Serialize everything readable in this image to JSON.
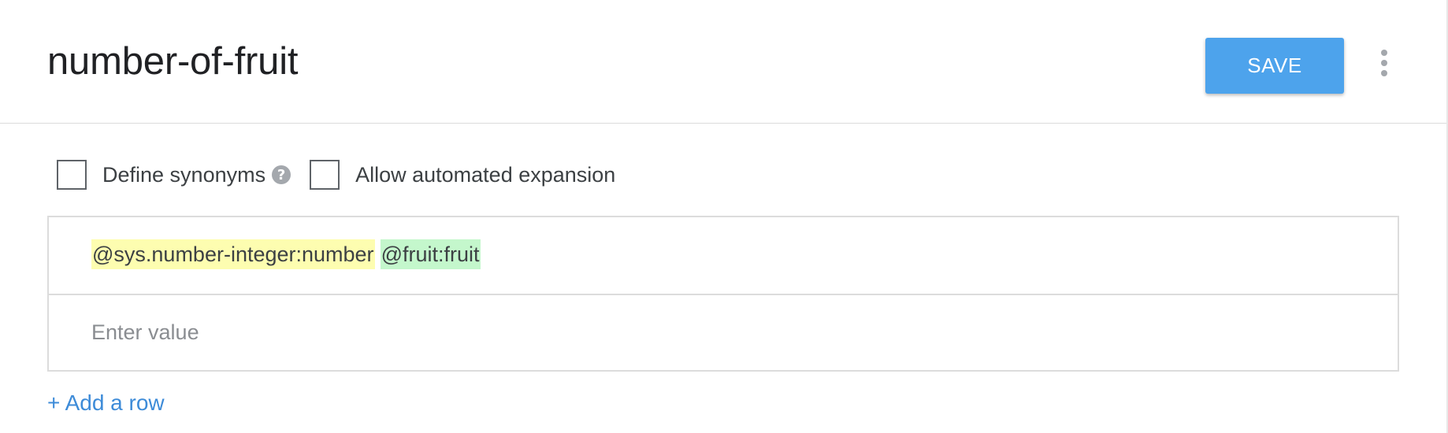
{
  "header": {
    "title": "number-of-fruit",
    "save_label": "SAVE",
    "more_icon": "more-vertical-icon"
  },
  "options": {
    "define_synonyms": {
      "label": "Define synonyms",
      "checked": false,
      "help_icon": "question-circle-icon",
      "help_glyph": "?"
    },
    "allow_expansion": {
      "label": "Allow automated expansion",
      "checked": false
    }
  },
  "entries": {
    "rows": [
      {
        "annotations": [
          {
            "text": "@sys.number-integer:number",
            "color": "#fdfdb0"
          },
          {
            "text": "@fruit:fruit",
            "color": "#c4f7cc"
          }
        ]
      }
    ],
    "new_row_placeholder": "Enter value"
  },
  "add_row_label": "+ Add a row",
  "colors": {
    "accent": "#4da3ec",
    "link": "#3d8bd8",
    "entity_sys": "#fdfdb0",
    "entity_custom": "#c4f7cc"
  }
}
